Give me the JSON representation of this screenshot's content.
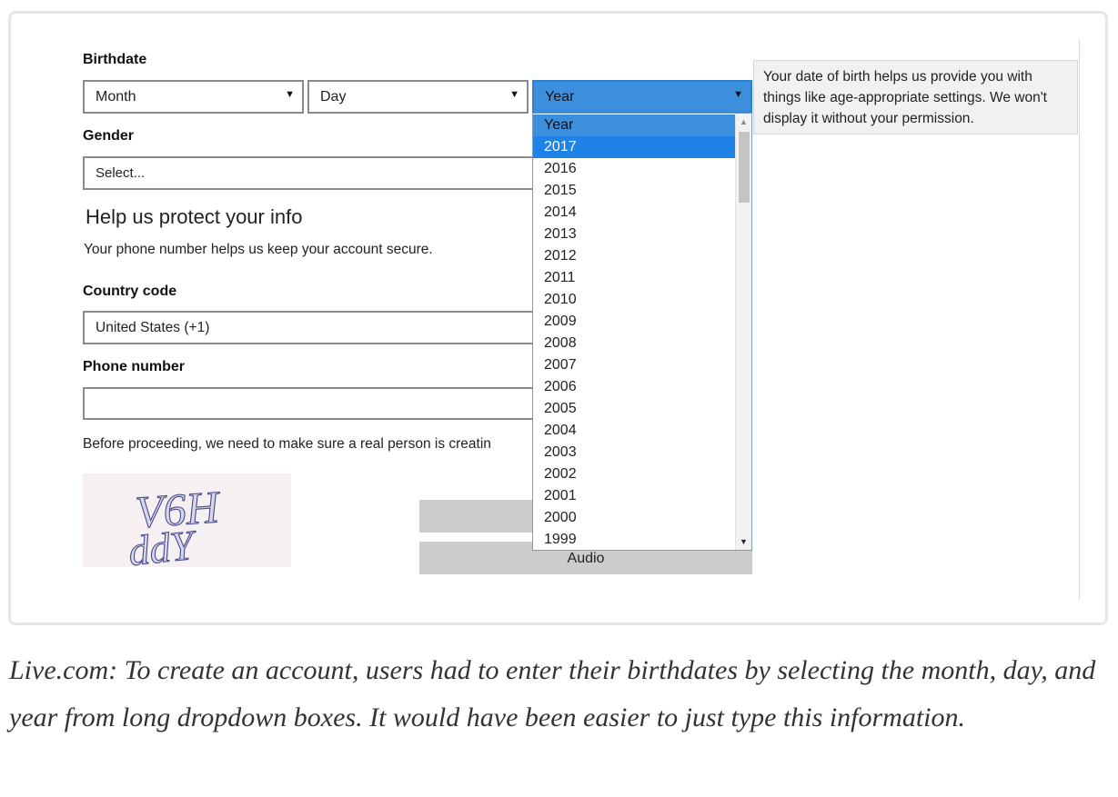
{
  "form": {
    "birthdate_label": "Birthdate",
    "month_value": "Month",
    "day_value": "Day",
    "year_value": "Year",
    "gender_label": "Gender",
    "gender_value": "Select...",
    "section_title": "Help us protect your info",
    "section_desc": "Your phone number helps us keep your account secure.",
    "country_label": "Country code",
    "country_value": "United States (+1)",
    "phone_label": "Phone number",
    "phone_value": "",
    "captcha_prompt": "Before proceeding, we need to make sure a real person is creatin",
    "captcha_line1": "V6H",
    "captcha_line2": "ddY",
    "audio_label": "Audio",
    "dropdown_arrow": "▼"
  },
  "tooltip": {
    "text": "Your date of birth helps us provide you with things like age-appropriate settings. We won't display it without your permission."
  },
  "year_dropdown": {
    "options": [
      "Year",
      "2017",
      "2016",
      "2015",
      "2014",
      "2013",
      "2012",
      "2011",
      "2010",
      "2009",
      "2008",
      "2007",
      "2006",
      "2005",
      "2004",
      "2003",
      "2002",
      "2001",
      "2000",
      "1999"
    ],
    "selected_index": 0,
    "highlighted_index": 1,
    "scroll_fraction": 0.1
  },
  "colors": {
    "accent": "#3c8fdd",
    "highlight": "#1e82e6"
  },
  "caption": "Live.com: To create an account, users had to enter their birthdates by selecting the month, day, and year from long dropdown boxes. It would have been easier to just type this information."
}
